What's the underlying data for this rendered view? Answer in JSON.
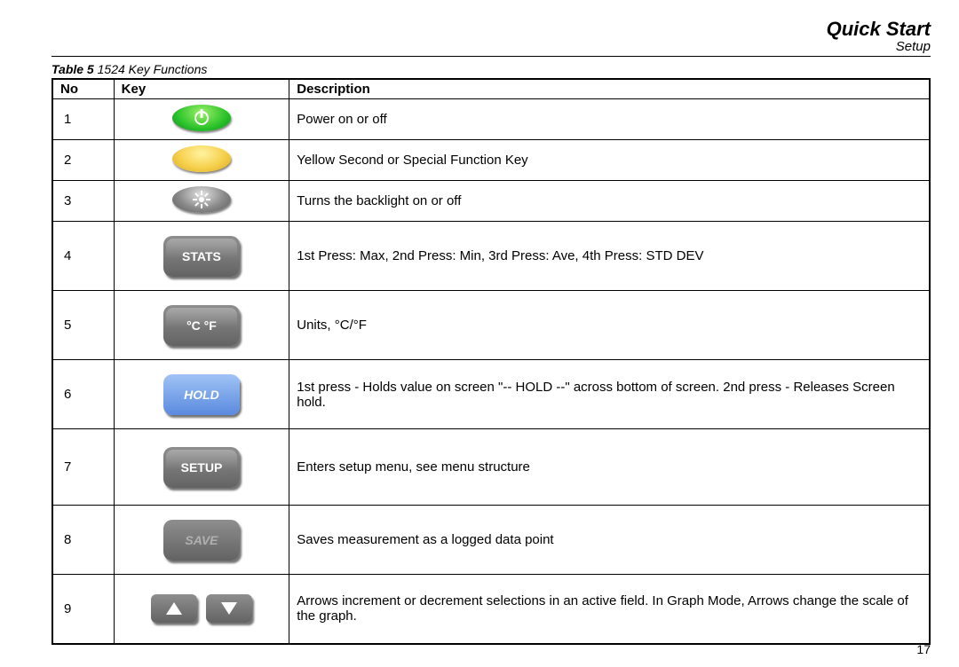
{
  "header": {
    "title": "Quick Start",
    "subtitle": "Setup"
  },
  "caption": {
    "prefix": "Table 5",
    "rest": " 1524 Key Functions"
  },
  "columns": {
    "no": "No",
    "key": "Key",
    "desc": "Description"
  },
  "rows": [
    {
      "no": "1",
      "key_label": "",
      "desc": "Power on or off",
      "icon": "power-green"
    },
    {
      "no": "2",
      "key_label": "",
      "desc": "Yellow Second or Special Function Key",
      "icon": "yellow-blank"
    },
    {
      "no": "3",
      "key_label": "",
      "desc": "Turns the backlight on or off",
      "icon": "backlight-gray"
    },
    {
      "no": "4",
      "key_label": "STATS",
      "desc": "1st Press: Max, 2nd Press: Min, 3rd Press: Ave, 4th Press: STD DEV",
      "icon": "rect-gray"
    },
    {
      "no": "5",
      "key_label": "°C °F",
      "desc": "Units, °C/°F",
      "icon": "rect-gray"
    },
    {
      "no": "6",
      "key_label": "HOLD",
      "desc": "1st press - Holds value on screen \"-- HOLD --\" across bottom of screen. 2nd press - Releases Screen hold.",
      "icon": "rect-blue"
    },
    {
      "no": "7",
      "key_label": "SETUP",
      "desc": "Enters setup menu, see menu structure",
      "icon": "rect-gray"
    },
    {
      "no": "8",
      "key_label": "SAVE",
      "desc": "Saves measurement as a logged data point",
      "icon": "rect-gray-dim"
    },
    {
      "no": "9",
      "key_label": "",
      "desc": "Arrows increment or decrement selections in an active field. In Graph Mode, Arrows change the scale of the graph.",
      "icon": "arrows"
    }
  ],
  "page_number": "17"
}
